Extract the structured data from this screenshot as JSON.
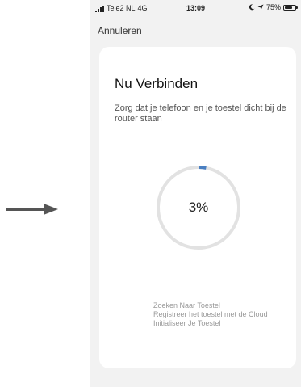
{
  "status_bar": {
    "carrier": "Tele2 NL",
    "network": "4G",
    "time": "13:09",
    "battery_percent": "75%",
    "battery_level": 0.75,
    "icons": [
      "signal-icon",
      "moon-icon",
      "location-icon",
      "battery-icon"
    ]
  },
  "nav": {
    "cancel_label": "Annuleren"
  },
  "card": {
    "title": "Nu Verbinden",
    "description": "Zorg dat je telefoon en je toestel dicht bij de router staan",
    "progress": {
      "value": 3,
      "label": "3%"
    },
    "steps": [
      "Zoeken Naar Toestel",
      "Registreer het toestel met de Cloud",
      "Initialiseer Je Toestel"
    ]
  },
  "colors": {
    "progress_accent": "#4a7fc1",
    "progress_track": "#e2e2e2",
    "arrow": "#555555",
    "app_background": "#f2f2f2"
  }
}
